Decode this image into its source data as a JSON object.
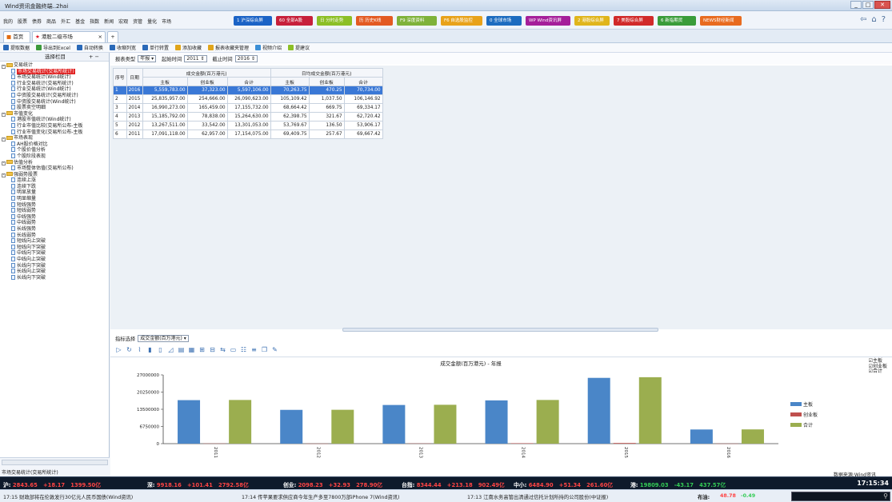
{
  "window": {
    "title": "Wind资讯金融终端..2hai"
  },
  "menu": [
    "我的",
    "股票",
    "债券",
    "商品",
    "外汇",
    "基金",
    "指数",
    "新闻",
    "宏观",
    "资管",
    "量化",
    "市场"
  ],
  "quick_buttons": [
    {
      "label": "1 沪深综合屏",
      "color": "#1b63c6"
    },
    {
      "label": "60 全部A股",
      "color": "#c7203b"
    },
    {
      "label": "日 分时走势",
      "color": "#8cbf26"
    },
    {
      "label": "历 历史K线",
      "color": "#e35a22"
    },
    {
      "label": "F9 深度资料",
      "color": "#7fb23a"
    },
    {
      "label": "F6 自选股监控",
      "color": "#e8a21a"
    },
    {
      "label": "0 全球市场",
      "color": "#1d6cc0"
    },
    {
      "label": "WP Wind资讯屏",
      "color": "#a51f9a"
    },
    {
      "label": "2 港股综合屏",
      "color": "#e0b51c"
    },
    {
      "label": "7 美股综合屏",
      "color": "#d12a2a"
    },
    {
      "label": "6 新指期货",
      "color": "#3a9c3a"
    },
    {
      "label": "NEWS财经新闻",
      "color": "#e86b1f"
    }
  ],
  "tabs": {
    "home": "首页",
    "active": "港股二级市场"
  },
  "toolbar": [
    "提取数据",
    "导出到Excel",
    "自动转换",
    "收缩列宽",
    "单行转置",
    "添加收藏",
    "报表收藏夹管理",
    "视频介绍",
    "提建议"
  ],
  "sidebar": {
    "header": "选择栏目",
    "pm": "+ −",
    "tree": [
      {
        "t": "f",
        "label": "交易统计"
      },
      {
        "t": "l",
        "label": "市场交易统计(交易所统计)",
        "sel": true
      },
      {
        "t": "l",
        "label": "市场交易统计(Wind统计)"
      },
      {
        "t": "l",
        "label": "行业交易统计(交易所统计)"
      },
      {
        "t": "l",
        "label": "行业交易统计(Wind统计)"
      },
      {
        "t": "l",
        "label": "中资股交易统计(交易所统计)"
      },
      {
        "t": "l",
        "label": "中资股交易统计(Wind统计)"
      },
      {
        "t": "l",
        "label": "股票卖空明细"
      },
      {
        "t": "f",
        "label": "市值变化"
      },
      {
        "t": "l",
        "label": "港股市值统计(Wind统计)"
      },
      {
        "t": "l",
        "label": "行业市值比较(交易所公布-主板"
      },
      {
        "t": "l",
        "label": "行业市值变化(交易所公布-主板"
      },
      {
        "t": "f",
        "label": "市场表现"
      },
      {
        "t": "l",
        "label": "AH股价格对比"
      },
      {
        "t": "l",
        "label": "个股价值分析"
      },
      {
        "t": "l",
        "label": "个股阶段表现"
      },
      {
        "t": "f",
        "label": "估值分析"
      },
      {
        "t": "l",
        "label": "市场整体估值(交易所公布)"
      },
      {
        "t": "f",
        "label": "强弱势股票"
      },
      {
        "t": "l",
        "label": "连续上涨"
      },
      {
        "t": "l",
        "label": "连续下跌"
      },
      {
        "t": "l",
        "label": "明显放量"
      },
      {
        "t": "l",
        "label": "明显缩量"
      },
      {
        "t": "l",
        "label": "短线强势"
      },
      {
        "t": "l",
        "label": "短线弱势"
      },
      {
        "t": "l",
        "label": "中线强势"
      },
      {
        "t": "l",
        "label": "中线弱势"
      },
      {
        "t": "l",
        "label": "长线强势"
      },
      {
        "t": "l",
        "label": "长线弱势"
      },
      {
        "t": "l",
        "label": "短线向上突破"
      },
      {
        "t": "l",
        "label": "短线向下突破"
      },
      {
        "t": "l",
        "label": "中线向下突破"
      },
      {
        "t": "l",
        "label": "中线向上突破"
      },
      {
        "t": "l",
        "label": "长线向下突破"
      },
      {
        "t": "l",
        "label": "长线向上突破"
      },
      {
        "t": "l",
        "label": "长线向下突破"
      }
    ],
    "footer": "市场交易统计(交易所统计)"
  },
  "filters": {
    "type_label": "报表类型",
    "type_value": "年报",
    "start_label": "起始时间",
    "start_value": "2011",
    "end_label": "截止时间",
    "end_value": "2016"
  },
  "table": {
    "group1": "成交金额(百万港元)",
    "group2": "日均成交金额(百万港元)",
    "columns": [
      "序号",
      "日期",
      "主板",
      "创业板",
      "合计",
      "主板",
      "创业板",
      "合计"
    ],
    "rows": [
      [
        "1",
        "2016",
        "5,559,783.00",
        "37,323.00",
        "5,597,106.00",
        "70,263.75",
        "470.25",
        "70,734.00"
      ],
      [
        "2",
        "2015",
        "25,835,957.00",
        "254,666.00",
        "26,090,623.00",
        "105,109.42",
        "1,037.50",
        "106,146.92"
      ],
      [
        "3",
        "2014",
        "16,990,273.00",
        "165,459.00",
        "17,155,732.00",
        "68,664.42",
        "669.75",
        "69,334.17"
      ],
      [
        "4",
        "2013",
        "15,185,792.00",
        "78,838.00",
        "15,264,630.00",
        "62,398.75",
        "321.67",
        "62,720.42"
      ],
      [
        "5",
        "2012",
        "13,267,511.00",
        "33,542.00",
        "13,301,053.00",
        "53,769.67",
        "136.50",
        "53,906.17"
      ],
      [
        "6",
        "2011",
        "17,091,118.00",
        "62,957.00",
        "17,154,075.00",
        "69,409.75",
        "257.67",
        "69,667.42"
      ]
    ]
  },
  "indicator": {
    "label": "指标选择",
    "value": "成交金额(百万港元)"
  },
  "chart_data": {
    "type": "bar",
    "title": "成交金额(百万港元) - 年报",
    "categories": [
      "2011",
      "2012",
      "2013",
      "2014",
      "2015",
      "2016"
    ],
    "series": [
      {
        "name": "主板",
        "color": "#4a86c8",
        "values": [
          17091118,
          13267511,
          15185792,
          16990273,
          25835957,
          5559783
        ]
      },
      {
        "name": "创业板",
        "color": "#c0504d",
        "values": [
          62957,
          33542,
          78838,
          165459,
          254666,
          37323
        ]
      },
      {
        "name": "合计",
        "color": "#9bae4f",
        "values": [
          17154075,
          13301053,
          15264630,
          17155732,
          26090623,
          5597106
        ]
      }
    ],
    "yticks": [
      "27000000",
      "20250000",
      "13500000",
      "6750000",
      "0"
    ],
    "ylim": [
      0,
      27000000
    ],
    "legend": "right"
  },
  "chart_checks": [
    "主板",
    "创业板",
    "合计"
  ],
  "source": "数据来源:Wind资讯",
  "quotes": [
    {
      "k": "沪:",
      "v": "2843.65",
      "c": "+18.17",
      "a": "1399.50亿",
      "dir": "up"
    },
    {
      "k": "深:",
      "v": "9918.16",
      "c": "+101.41",
      "a": "2792.58亿",
      "dir": "up"
    },
    {
      "k": "创业:",
      "v": "2098.23",
      "c": "+32.93",
      "a": "278.90亿",
      "dir": "up"
    },
    {
      "k": "台指:",
      "v": "8344.44",
      "c": "+213.18",
      "a": "902.49亿",
      "dir": "up"
    },
    {
      "k": "中小:",
      "v": "6484.90",
      "c": "+51.34",
      "a": "261.60亿",
      "dir": "up"
    },
    {
      "k": "港:",
      "v": "19809.03",
      "c": "-43.17",
      "a": "437.57亿",
      "dir": "dn"
    }
  ],
  "clock": "17:15:34",
  "news": [
    "17:15 财政部将在伦敦发行30亿元人民币国债(Wind资讯)",
    "17:14 传苹果要求供应商今年生产多至7800万部iPhone 7(Wind资讯)",
    "17:13 江南水务高管出清通过信托计划所持的公司股份(中证报)"
  ],
  "ticker": {
    "k": "布油:",
    "v": "48.78",
    "c": "-0.49"
  }
}
